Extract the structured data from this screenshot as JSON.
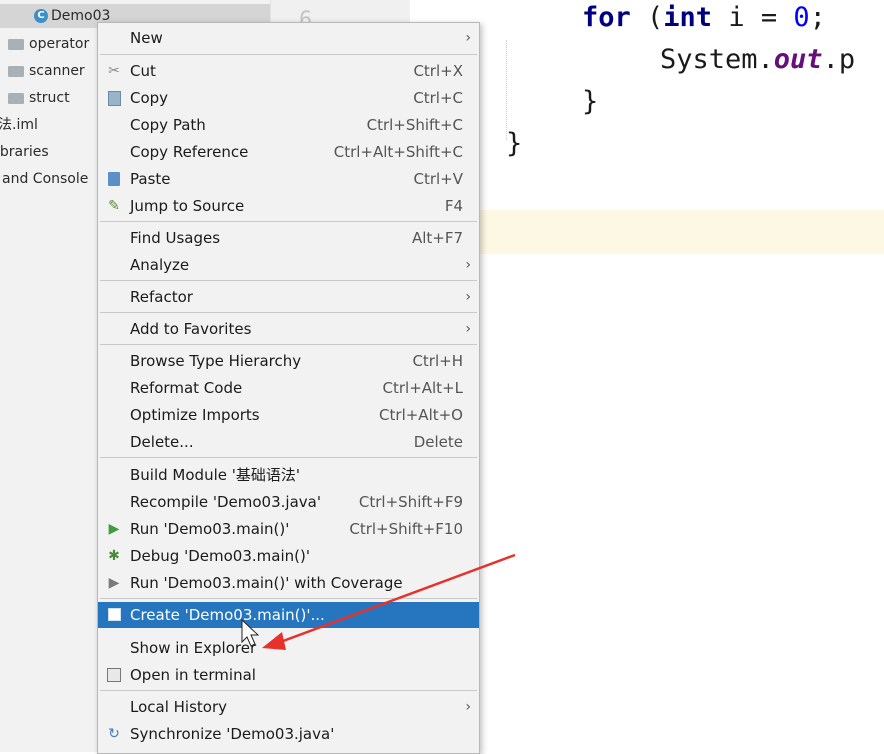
{
  "project_tree": {
    "selected_file": "Demo03",
    "items": [
      "operator",
      "scanner",
      "struct",
      "法.iml",
      "ibraries",
      "and Console"
    ]
  },
  "gutter": {
    "line_number": "6"
  },
  "editor": {
    "line1": {
      "keyword1": "for",
      "paren": " (",
      "keyword2": "int",
      "rest": " i = ",
      "number": "0",
      "end": ";"
    },
    "line2": {
      "prefix": "System.",
      "field": "out",
      "suffix": ".p"
    },
    "line3": "}",
    "line4": "}"
  },
  "context_menu": {
    "items": [
      {
        "label": "New",
        "shortcut": "",
        "submenu": true
      },
      {
        "label": "Cut",
        "shortcut": "Ctrl+X",
        "icon": "scissors-icon"
      },
      {
        "label": "Copy",
        "shortcut": "Ctrl+C",
        "icon": "copy-icon"
      },
      {
        "label": "Copy Path",
        "shortcut": "Ctrl+Shift+C"
      },
      {
        "label": "Copy Reference",
        "shortcut": "Ctrl+Alt+Shift+C"
      },
      {
        "label": "Paste",
        "shortcut": "Ctrl+V",
        "icon": "paste-icon"
      },
      {
        "label": "Jump to Source",
        "shortcut": "F4",
        "icon": "jump-icon"
      },
      {
        "label": "Find Usages",
        "shortcut": "Alt+F7"
      },
      {
        "label": "Analyze",
        "shortcut": "",
        "submenu": true
      },
      {
        "label": "Refactor",
        "shortcut": "",
        "submenu": true
      },
      {
        "label": "Add to Favorites",
        "shortcut": "",
        "submenu": true
      },
      {
        "label": "Browse Type Hierarchy",
        "shortcut": "Ctrl+H"
      },
      {
        "label": "Reformat Code",
        "shortcut": "Ctrl+Alt+L"
      },
      {
        "label": "Optimize Imports",
        "shortcut": "Ctrl+Alt+O"
      },
      {
        "label": "Delete...",
        "shortcut": "Delete"
      },
      {
        "label": "Build Module '基础语法'",
        "shortcut": ""
      },
      {
        "label": "Recompile 'Demo03.java'",
        "shortcut": "Ctrl+Shift+F9"
      },
      {
        "label": "Run 'Demo03.main()'",
        "shortcut": "Ctrl+Shift+F10",
        "icon": "run-icon"
      },
      {
        "label": "Debug 'Demo03.main()'",
        "shortcut": "",
        "icon": "debug-icon"
      },
      {
        "label": "Run 'Demo03.main()' with Coverage",
        "shortcut": "",
        "icon": "coverage-icon"
      },
      {
        "label": "Create 'Demo03.main()'...",
        "shortcut": "",
        "icon": "create-config-icon"
      },
      {
        "label": "Show in Explorer",
        "shortcut": ""
      },
      {
        "label": "Open in terminal",
        "shortcut": "",
        "icon": "terminal-icon"
      },
      {
        "label": "Local History",
        "shortcut": "",
        "submenu": true
      },
      {
        "label": "Synchronize 'Demo03.java'",
        "shortcut": "",
        "icon": "sync-icon"
      }
    ],
    "active_index": 20
  },
  "colors": {
    "menu_highlight": "#2675bf",
    "annotation_arrow": "#e8312a"
  }
}
